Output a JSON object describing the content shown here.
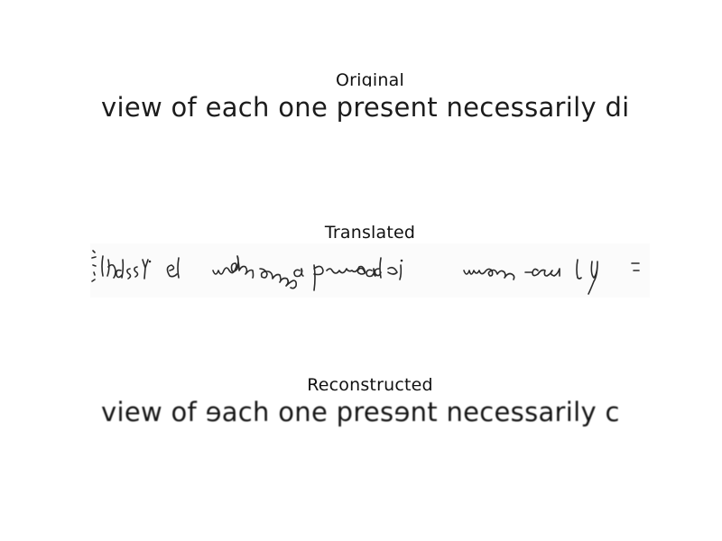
{
  "panels": {
    "original": {
      "title": "Original",
      "text": "view of each one present necessarily di"
    },
    "translated": {
      "title": "Translated"
    },
    "reconstructed": {
      "title": "Reconstructed",
      "text": "view of ɘach one presɘnt necessarily c"
    }
  },
  "colors": {
    "text": "#1c1c1c",
    "background": "#ffffff"
  }
}
